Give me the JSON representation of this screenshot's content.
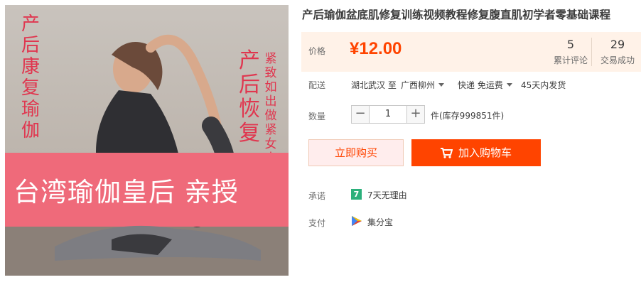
{
  "product": {
    "title": "产后瑜伽盆底肌修复训练视频教程修复腹直肌初学者零基础课程",
    "image": {
      "text_left": "产后康复瑜伽",
      "text_right_big": "产后恢复",
      "text_right_small": "紧致如出做紧女人",
      "banner": "台湾瑜伽皇后 亲授"
    }
  },
  "price": {
    "label": "价格",
    "value": "¥12.00",
    "reviews_count": "5",
    "reviews_label": "累计评论",
    "deals_count": "29",
    "deals_label": "交易成功"
  },
  "shipping": {
    "label": "配送",
    "from": "湖北武汉 至",
    "to": "广西柳州",
    "method": "快递 免运费",
    "dispatch": "45天内发货"
  },
  "quantity": {
    "label": "数量",
    "value": "1",
    "minus": "−",
    "plus": "+",
    "stock": "件(库存999851件)"
  },
  "actions": {
    "buy_now": "立即购买",
    "add_to_cart": "加入购物车"
  },
  "promise": {
    "label": "承诺",
    "icon_text": "7",
    "text": "7天无理由"
  },
  "payment": {
    "label": "支付",
    "text": "集分宝"
  },
  "colors": {
    "accent": "#ff4400",
    "price_bg": "#fff2e8",
    "banner": "#ef6a7a"
  }
}
